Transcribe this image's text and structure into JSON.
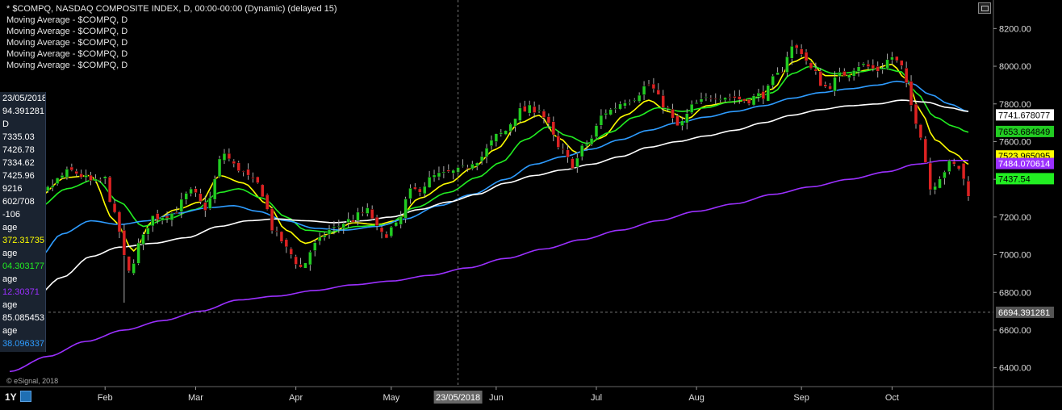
{
  "legend": {
    "title": "* $COMPQ, NASDAQ COMPOSITE INDEX, D, 00:00-00:00 (Dynamic) (delayed 15)",
    "ma_lines": [
      "Moving Average - $COMPQ, D",
      "Moving Average - $COMPQ, D",
      "Moving Average - $COMPQ, D",
      "Moving Average - $COMPQ, D",
      "Moving Average - $COMPQ, D"
    ]
  },
  "side_panel": {
    "date": "23/05/2018",
    "rows": [
      {
        "text": "94.391281",
        "color": "#ffffff"
      },
      {
        "text": "D",
        "color": "#ffffff"
      },
      {
        "text": "7335.03",
        "color": "#ffffff"
      },
      {
        "text": "7426.78",
        "color": "#ffffff"
      },
      {
        "text": "7334.62",
        "color": "#ffffff"
      },
      {
        "text": "7425.96",
        "color": "#ffffff"
      },
      {
        "text": "9216",
        "color": "#ffffff"
      },
      {
        "text": "602/708",
        "color": "#ffffff"
      },
      {
        "text": "-106",
        "color": "#ffffff"
      },
      {
        "text": "age",
        "color": "#ffffff"
      },
      {
        "text": "372.31735",
        "color": "#ffff00"
      },
      {
        "text": "age",
        "color": "#ffffff"
      },
      {
        "text": "04.303177",
        "color": "#22ee22"
      },
      {
        "text": "age",
        "color": "#ffffff"
      },
      {
        "text": "12.30371",
        "color": "#9b30ff"
      },
      {
        "text": "age",
        "color": "#ffffff"
      },
      {
        "text": "85.085453",
        "color": "#ffffff"
      },
      {
        "text": "age",
        "color": "#ffffff"
      },
      {
        "text": "38.096337",
        "color": "#2e9cff"
      }
    ]
  },
  "timeframe": "1Y",
  "watermark": "© eSignal, 2018",
  "cursor": {
    "date_label": "23/05/2018",
    "value_label": "6694.391281",
    "date_index": 94,
    "value": 6694.39
  },
  "colors": {
    "up": "#22cc22",
    "down": "#dd2222",
    "ma10": "#ffff00",
    "ma20": "#22ee22",
    "ma50": "#2e9cff",
    "ma100": "#ffffff",
    "ma200": "#9b30ff"
  },
  "chart_data": {
    "type": "candlestick",
    "title": "* $COMPQ, NASDAQ COMPOSITE INDEX, D, 00:00-00:00 (Dynamic) (delayed 15)",
    "ylim": [
      6300,
      8300
    ],
    "yticks": [
      8200,
      8000,
      7800,
      7600,
      7400,
      7200,
      7000,
      6800,
      6600,
      6400
    ],
    "xlabels": [
      {
        "label": "Feb",
        "index": 20
      },
      {
        "label": "Mar",
        "index": 39
      },
      {
        "label": "Apr",
        "index": 60
      },
      {
        "label": "May",
        "index": 80
      },
      {
        "label": "Jun",
        "index": 102
      },
      {
        "label": "Jul",
        "index": 123
      },
      {
        "label": "Aug",
        "index": 144
      },
      {
        "label": "Sep",
        "index": 166
      },
      {
        "label": "Oct",
        "index": 185
      }
    ],
    "anchors": [
      [
        0,
        7150
      ],
      [
        5,
        7300
      ],
      [
        13,
        7440
      ],
      [
        18,
        7380
      ],
      [
        20,
        7400
      ],
      [
        22,
        7200
      ],
      [
        25,
        6900
      ],
      [
        27,
        7050
      ],
      [
        30,
        7200
      ],
      [
        34,
        7220
      ],
      [
        38,
        7330
      ],
      [
        41,
        7250
      ],
      [
        45,
        7540
      ],
      [
        47,
        7470
      ],
      [
        52,
        7370
      ],
      [
        56,
        7100
      ],
      [
        59,
        7000
      ],
      [
        61,
        6930
      ],
      [
        64,
        7050
      ],
      [
        67,
        7130
      ],
      [
        71,
        7180
      ],
      [
        75,
        7230
      ],
      [
        78,
        7100
      ],
      [
        81,
        7150
      ],
      [
        84,
        7330
      ],
      [
        90,
        7420
      ],
      [
        94,
        7440
      ],
      [
        98,
        7510
      ],
      [
        103,
        7640
      ],
      [
        107,
        7760
      ],
      [
        111,
        7780
      ],
      [
        113,
        7680
      ],
      [
        115,
        7560
      ],
      [
        118,
        7480
      ],
      [
        121,
        7590
      ],
      [
        125,
        7760
      ],
      [
        130,
        7830
      ],
      [
        134,
        7900
      ],
      [
        137,
        7800
      ],
      [
        140,
        7680
      ],
      [
        144,
        7800
      ],
      [
        148,
        7850
      ],
      [
        151,
        7840
      ],
      [
        154,
        7820
      ],
      [
        158,
        7850
      ],
      [
        161,
        7950
      ],
      [
        164,
        8100
      ],
      [
        166,
        8080
      ],
      [
        168,
        7980
      ],
      [
        171,
        7890
      ],
      [
        175,
        7960
      ],
      [
        178,
        8010
      ],
      [
        182,
        7980
      ],
      [
        185,
        8050
      ],
      [
        187,
        7990
      ],
      [
        189,
        7790
      ],
      [
        191,
        7640
      ],
      [
        193,
        7350
      ],
      [
        195,
        7420
      ],
      [
        197,
        7480
      ],
      [
        199,
        7460
      ],
      [
        201,
        7330
      ]
    ],
    "series": [
      {
        "key": "ma10",
        "anchors": [
          [
            0,
            7210
          ],
          [
            5,
            7290
          ],
          [
            12,
            7410
          ],
          [
            17,
            7420
          ],
          [
            22,
            7180
          ],
          [
            26,
            7020
          ],
          [
            30,
            7180
          ],
          [
            35,
            7240
          ],
          [
            40,
            7280
          ],
          [
            44,
            7420
          ],
          [
            49,
            7380
          ],
          [
            54,
            7270
          ],
          [
            58,
            7130
          ],
          [
            62,
            7060
          ],
          [
            67,
            7110
          ],
          [
            72,
            7170
          ],
          [
            77,
            7160
          ],
          [
            81,
            7180
          ],
          [
            86,
            7300
          ],
          [
            92,
            7380
          ],
          [
            97,
            7460
          ],
          [
            102,
            7560
          ],
          [
            107,
            7700
          ],
          [
            111,
            7740
          ],
          [
            115,
            7620
          ],
          [
            119,
            7540
          ],
          [
            124,
            7620
          ],
          [
            129,
            7740
          ],
          [
            134,
            7820
          ],
          [
            138,
            7760
          ],
          [
            142,
            7720
          ],
          [
            146,
            7790
          ],
          [
            151,
            7810
          ],
          [
            155,
            7820
          ],
          [
            160,
            7880
          ],
          [
            164,
            8020
          ],
          [
            167,
            8050
          ],
          [
            171,
            7950
          ],
          [
            175,
            7950
          ],
          [
            180,
            7980
          ],
          [
            185,
            8010
          ],
          [
            188,
            7930
          ],
          [
            191,
            7760
          ],
          [
            194,
            7610
          ],
          [
            198,
            7540
          ],
          [
            201,
            7480
          ]
        ]
      },
      {
        "key": "ma20",
        "anchors": [
          [
            0,
            7140
          ],
          [
            6,
            7250
          ],
          [
            12,
            7350
          ],
          [
            18,
            7400
          ],
          [
            23,
            7280
          ],
          [
            28,
            7150
          ],
          [
            33,
            7190
          ],
          [
            39,
            7240
          ],
          [
            44,
            7330
          ],
          [
            48,
            7350
          ],
          [
            53,
            7300
          ],
          [
            58,
            7200
          ],
          [
            62,
            7130
          ],
          [
            67,
            7120
          ],
          [
            73,
            7150
          ],
          [
            79,
            7160
          ],
          [
            85,
            7250
          ],
          [
            92,
            7330
          ],
          [
            98,
            7410
          ],
          [
            103,
            7490
          ],
          [
            108,
            7610
          ],
          [
            113,
            7680
          ],
          [
            117,
            7630
          ],
          [
            121,
            7590
          ],
          [
            126,
            7650
          ],
          [
            131,
            7730
          ],
          [
            136,
            7780
          ],
          [
            141,
            7760
          ],
          [
            146,
            7780
          ],
          [
            151,
            7810
          ],
          [
            156,
            7830
          ],
          [
            160,
            7860
          ],
          [
            164,
            7960
          ],
          [
            168,
            8000
          ],
          [
            173,
            7960
          ],
          [
            178,
            7970
          ],
          [
            183,
            7990
          ],
          [
            187,
            7970
          ],
          [
            190,
            7860
          ],
          [
            194,
            7730
          ],
          [
            198,
            7680
          ],
          [
            201,
            7650
          ]
        ]
      },
      {
        "key": "ma50",
        "anchors": [
          [
            0,
            6840
          ],
          [
            6,
            6980
          ],
          [
            11,
            7110
          ],
          [
            17,
            7180
          ],
          [
            23,
            7160
          ],
          [
            29,
            7180
          ],
          [
            35,
            7220
          ],
          [
            42,
            7250
          ],
          [
            47,
            7260
          ],
          [
            52,
            7230
          ],
          [
            58,
            7180
          ],
          [
            64,
            7140
          ],
          [
            70,
            7130
          ],
          [
            77,
            7150
          ],
          [
            83,
            7190
          ],
          [
            90,
            7260
          ],
          [
            97,
            7320
          ],
          [
            104,
            7400
          ],
          [
            110,
            7480
          ],
          [
            116,
            7520
          ],
          [
            122,
            7560
          ],
          [
            128,
            7610
          ],
          [
            134,
            7660
          ],
          [
            140,
            7700
          ],
          [
            146,
            7730
          ],
          [
            152,
            7760
          ],
          [
            158,
            7790
          ],
          [
            164,
            7830
          ],
          [
            170,
            7860
          ],
          [
            176,
            7880
          ],
          [
            182,
            7900
          ],
          [
            186,
            7920
          ],
          [
            189,
            7910
          ],
          [
            193,
            7850
          ],
          [
            197,
            7800
          ],
          [
            201,
            7760
          ]
        ]
      },
      {
        "key": "ma100",
        "anchors": [
          [
            0,
            6700
          ],
          [
            5,
            6770
          ],
          [
            11,
            6880
          ],
          [
            17,
            6990
          ],
          [
            23,
            7040
          ],
          [
            30,
            7060
          ],
          [
            37,
            7090
          ],
          [
            44,
            7150
          ],
          [
            50,
            7180
          ],
          [
            56,
            7190
          ],
          [
            62,
            7180
          ],
          [
            68,
            7170
          ],
          [
            74,
            7180
          ],
          [
            80,
            7200
          ],
          [
            86,
            7240
          ],
          [
            92,
            7280
          ],
          [
            98,
            7320
          ],
          [
            104,
            7380
          ],
          [
            110,
            7420
          ],
          [
            116,
            7450
          ],
          [
            122,
            7480
          ],
          [
            128,
            7520
          ],
          [
            134,
            7570
          ],
          [
            140,
            7600
          ],
          [
            146,
            7630
          ],
          [
            152,
            7660
          ],
          [
            158,
            7700
          ],
          [
            164,
            7740
          ],
          [
            170,
            7770
          ],
          [
            176,
            7790
          ],
          [
            182,
            7800
          ],
          [
            187,
            7820
          ],
          [
            192,
            7810
          ],
          [
            197,
            7780
          ],
          [
            201,
            7760
          ]
        ]
      },
      {
        "key": "ma200",
        "anchors": [
          [
            0,
            6380
          ],
          [
            8,
            6460
          ],
          [
            16,
            6540
          ],
          [
            24,
            6600
          ],
          [
            32,
            6650
          ],
          [
            40,
            6700
          ],
          [
            48,
            6760
          ],
          [
            56,
            6780
          ],
          [
            64,
            6810
          ],
          [
            72,
            6840
          ],
          [
            80,
            6860
          ],
          [
            88,
            6890
          ],
          [
            96,
            6930
          ],
          [
            104,
            6980
          ],
          [
            112,
            7030
          ],
          [
            120,
            7080
          ],
          [
            128,
            7130
          ],
          [
            136,
            7180
          ],
          [
            144,
            7230
          ],
          [
            152,
            7270
          ],
          [
            160,
            7320
          ],
          [
            168,
            7360
          ],
          [
            176,
            7400
          ],
          [
            184,
            7440
          ],
          [
            190,
            7480
          ],
          [
            196,
            7500
          ],
          [
            201,
            7500
          ]
        ]
      }
    ],
    "price_labels": [
      {
        "text": "7741.678077",
        "value": 7741.68,
        "bg": "#ffffff",
        "fg": "#000000"
      },
      {
        "text": "7653.684849",
        "value": 7653.68,
        "bg": "#22cc22",
        "fg": "#000000"
      },
      {
        "text": "7523.965095",
        "value": 7523.97,
        "bg": "#ffff00",
        "fg": "#000000"
      },
      {
        "text": "7484.070614",
        "value": 7484.07,
        "bg": "#9b30ff",
        "fg": "#ffffff"
      },
      {
        "text": "7437.54",
        "value": 7437.54,
        "bg": "#22ee22",
        "fg": "#000000"
      }
    ]
  }
}
